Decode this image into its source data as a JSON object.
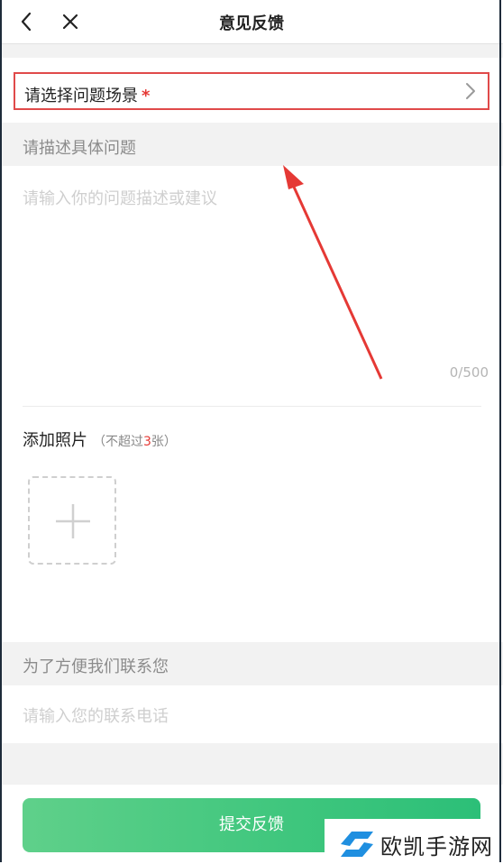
{
  "header": {
    "title": "意见反馈",
    "back_icon": "chevron-left-icon",
    "close_icon": "close-icon"
  },
  "scene_selector": {
    "label": "请选择问题场景",
    "required_mark": "*",
    "chevron_icon": "chevron-right-icon"
  },
  "description": {
    "section_title": "请描述具体问题",
    "placeholder": "请输入你的问题描述或建议",
    "counter": "0/500"
  },
  "photos": {
    "label": "添加照片",
    "hint_prefix": "（不超过",
    "hint_num": "3",
    "hint_suffix": "张）",
    "add_icon": "plus-icon"
  },
  "contact": {
    "section_title": "为了方便我们联系您",
    "placeholder": "请输入您的联系电话"
  },
  "submit": {
    "label": "提交反馈"
  },
  "watermark": {
    "text": "欧凯手游网"
  },
  "colors": {
    "accent_green": "#3ec67d",
    "required_red": "#e53935",
    "annotation_red": "#e04a4a"
  }
}
